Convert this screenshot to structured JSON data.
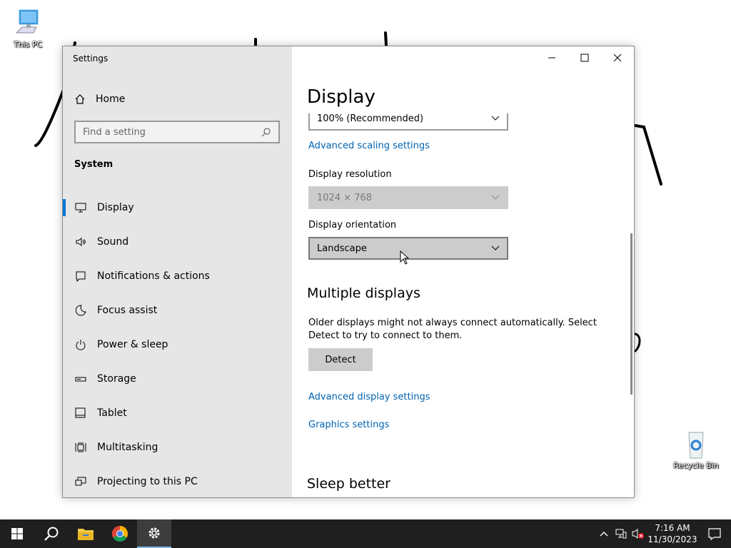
{
  "desktop": {
    "icons": [
      {
        "label": "This PC",
        "icon": "computer-icon"
      },
      {
        "label": "Recycle Bin",
        "icon": "recycle-bin-icon"
      }
    ]
  },
  "window": {
    "title": "Settings",
    "controls": [
      "minimize-icon",
      "maximize-icon",
      "close-icon"
    ]
  },
  "sidebar": {
    "home_label": "Home",
    "search_placeholder": "Find a setting",
    "section": "System",
    "items": [
      {
        "label": "Display",
        "icon": "monitor-icon",
        "active": true
      },
      {
        "label": "Sound",
        "icon": "speaker-icon"
      },
      {
        "label": "Notifications & actions",
        "icon": "notification-icon"
      },
      {
        "label": "Focus assist",
        "icon": "moon-icon"
      },
      {
        "label": "Power & sleep",
        "icon": "power-icon"
      },
      {
        "label": "Storage",
        "icon": "storage-icon"
      },
      {
        "label": "Tablet",
        "icon": "tablet-icon"
      },
      {
        "label": "Multitasking",
        "icon": "multitasking-icon"
      },
      {
        "label": "Projecting to this PC",
        "icon": "projecting-icon"
      }
    ]
  },
  "main": {
    "title": "Display",
    "scale_value": "100% (Recommended)",
    "advanced_scaling_link": "Advanced scaling settings",
    "resolution_label": "Display resolution",
    "resolution_value": "1024 × 768",
    "orientation_label": "Display orientation",
    "orientation_value": "Landscape",
    "multiple_displays_heading": "Multiple displays",
    "multiple_displays_text": "Older displays might not always connect automatically. Select Detect to try to connect to them.",
    "detect_button": "Detect",
    "advanced_display_link": "Advanced display settings",
    "graphics_link": "Graphics settings",
    "sleep_heading": "Sleep better"
  },
  "taskbar": {
    "apps": [
      "start-icon",
      "search-icon",
      "file-explorer-icon",
      "chrome-icon",
      "settings-icon"
    ],
    "time": "7:16 AM",
    "date": "11/30/2023"
  },
  "colors": {
    "accent": "#0078d7",
    "link": "#0063b1",
    "taskbar": "#1f1f1f",
    "sidebar": "#e6e6e6"
  }
}
